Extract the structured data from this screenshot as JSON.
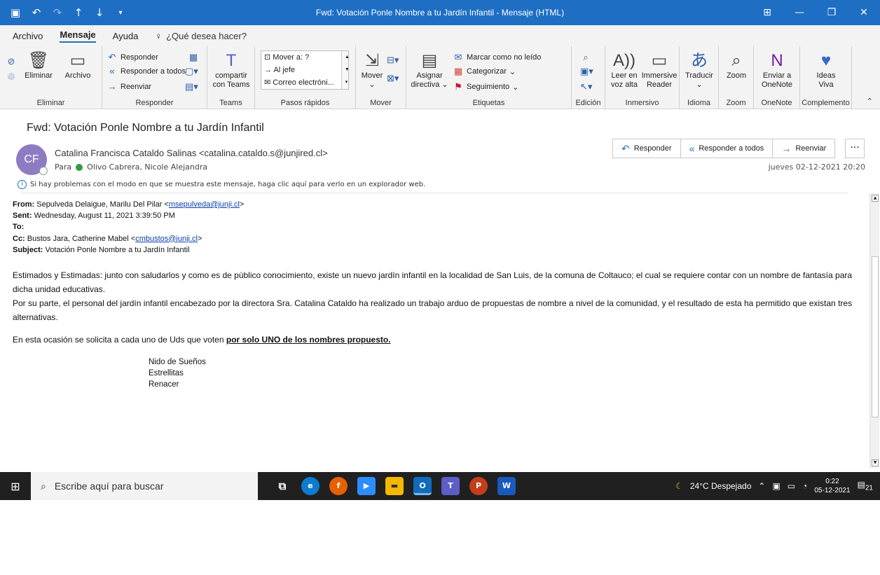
{
  "window": {
    "title": "Fwd: Votación Ponle Nombre a tu Jardín Infantil  -  Mensaje (HTML)"
  },
  "menu": {
    "tabs": [
      "Archivo",
      "Mensaje",
      "Ayuda"
    ],
    "search_placeholder": "¿Qué desea hacer?"
  },
  "ribbon": {
    "eliminar": {
      "delete_label": "Eliminar",
      "archive_label": "Archivo",
      "group": "Eliminar"
    },
    "responder": {
      "reply": "Responder",
      "reply_all": "Responder a todos",
      "forward": "Reenviar",
      "group": "Responder"
    },
    "teams": {
      "share": "compartir",
      "share2": "con Teams",
      "group": "Teams"
    },
    "quicksteps": {
      "items": [
        "Mover a: ?",
        "Al jefe",
        "Correo electróni..."
      ],
      "group": "Pasos rápidos"
    },
    "mover": {
      "move": "Mover",
      "group": "Mover"
    },
    "etiquetas": {
      "assign": "Asignar",
      "assign2": "directiva",
      "unread": "Marcar como no leído",
      "categorize": "Categorizar",
      "followup": "Seguimiento",
      "group": "Etiquetas"
    },
    "edicion": {
      "group": "Edición"
    },
    "inmersivo": {
      "read": "Leer en",
      "read2": "voz alta",
      "immersive": "Immersive",
      "immersive2": "Reader",
      "group": "Inmersivo"
    },
    "idioma": {
      "translate": "Traducir",
      "group": "Idioma"
    },
    "zoom": {
      "zoom": "Zoom",
      "group": "Zoom"
    },
    "onenote": {
      "send": "Enviar a",
      "send2": "OneNote",
      "group": "OneNote"
    },
    "complemento": {
      "ideas": "Ideas",
      "ideas2": "Viva",
      "group": "Complemento"
    }
  },
  "message": {
    "subject": "Fwd: Votación Ponle Nombre a tu Jardín Infantil",
    "avatar_initials": "CF",
    "sender": "Catalina Francisca Cataldo Salinas <catalina.cataldo.s@junjired.cl>",
    "to_label": "Para",
    "to_name": "Olivo Cabrera, Nicole Alejandra",
    "info": "Si hay problemas con el modo en que se muestra este mensaje, haga clic aquí para verlo en un explorador web.",
    "date": "jueves 02-12-2021 20:20",
    "actions": {
      "reply": "Responder",
      "reply_all": "Responder a todos",
      "forward": "Reenviar",
      "more": "···"
    }
  },
  "body": {
    "from_label": "From:",
    "from_name": "Sepulveda Delaigue, Marilu Del Pilar <",
    "from_email": "msepulveda@junji.cl",
    "sent_label": "Sent:",
    "sent_value": "Wednesday, August 11, 2021 3:39:50 PM",
    "to_label": "To:",
    "cc_label": "Cc:",
    "cc_name": "Bustos Jara, Catherine Mabel <",
    "cc_email": "cmbustos@junji.cl",
    "subject_label": "Subject:",
    "subject_value": "Votación Ponle Nombre a tu Jardín Infantil",
    "p1": "Estimados y Estimadas: junto con saludarlos y como es de público conocimiento, existe un nuevo jardín infantil en la localidad de San Luis, de la comuna de Coltauco; el cual se requiere contar con un nombre de fantasía para dicha unidad educativas.",
    "p2": "Por su parte, el personal del jardín infantil encabezado por la directora Sra. Catalina Cataldo ha realizado un trabajo arduo de propuestas de nombre a nivel de la comunidad, y el resultado de esta ha permitido que existan tres alternativas.",
    "p3_pre": "En esta ocasión se solicita a cada uno de Uds que voten ",
    "p3_bold": "por solo UNO  de los nombres propuesto.",
    "options": [
      "Nido de Sueños",
      "Estrellitas",
      "Renacer"
    ]
  },
  "taskbar": {
    "search_placeholder": "Escribe aquí para buscar",
    "weather": "24°C  Despejado",
    "time": "0:22",
    "date": "05-12-2021",
    "notifications": "21"
  }
}
